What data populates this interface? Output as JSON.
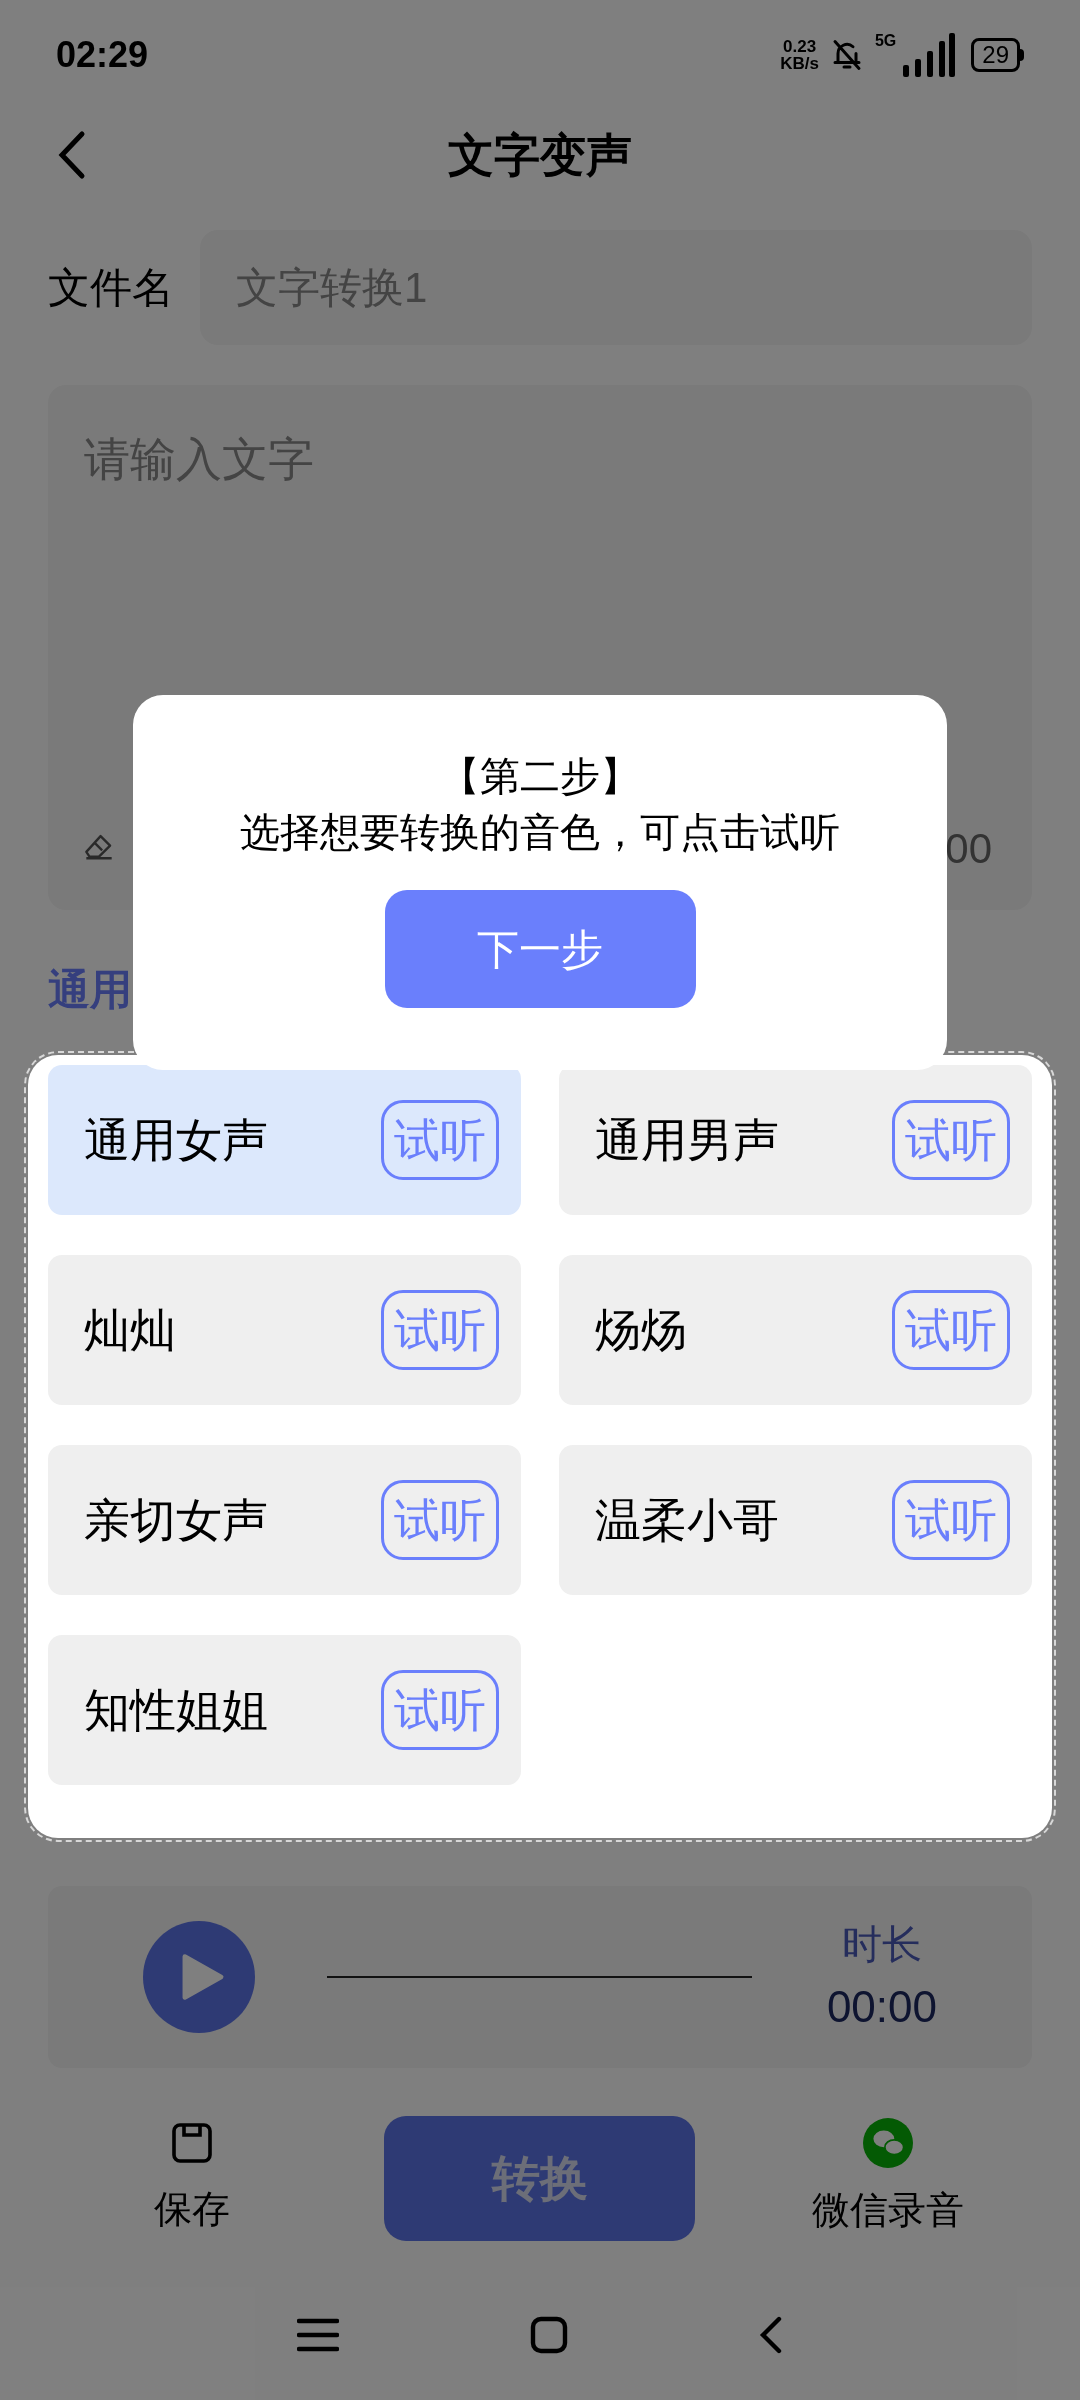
{
  "status_bar": {
    "time": "02:29",
    "net_speed": [
      "0.23",
      "KB/s"
    ],
    "network": "5G",
    "battery": "29"
  },
  "header": {
    "title": "文字变声"
  },
  "file_name": {
    "label": "文件名",
    "placeholder": "文字转换1"
  },
  "text_input": {
    "placeholder": "请输入文字",
    "counter": "00"
  },
  "section_label": "通用",
  "voices": [
    {
      "name": "通用女声",
      "selected": true,
      "preview": "试听"
    },
    {
      "name": "通用男声",
      "selected": false,
      "preview": "试听"
    },
    {
      "name": "灿灿",
      "selected": false,
      "preview": "试听"
    },
    {
      "name": "炀炀",
      "selected": false,
      "preview": "试听"
    },
    {
      "name": "亲切女声",
      "selected": false,
      "preview": "试听"
    },
    {
      "name": "温柔小哥",
      "selected": false,
      "preview": "试听"
    },
    {
      "name": "知性姐姐",
      "selected": false,
      "preview": "试听"
    }
  ],
  "player": {
    "duration_label": "时长",
    "duration": "00:00"
  },
  "actions": {
    "save": "保存",
    "convert": "转换",
    "wechat": "微信录音"
  },
  "guide": {
    "step": "【第二步】",
    "message": "选择想要转换的音色，可点击试听",
    "next": "下一步"
  }
}
